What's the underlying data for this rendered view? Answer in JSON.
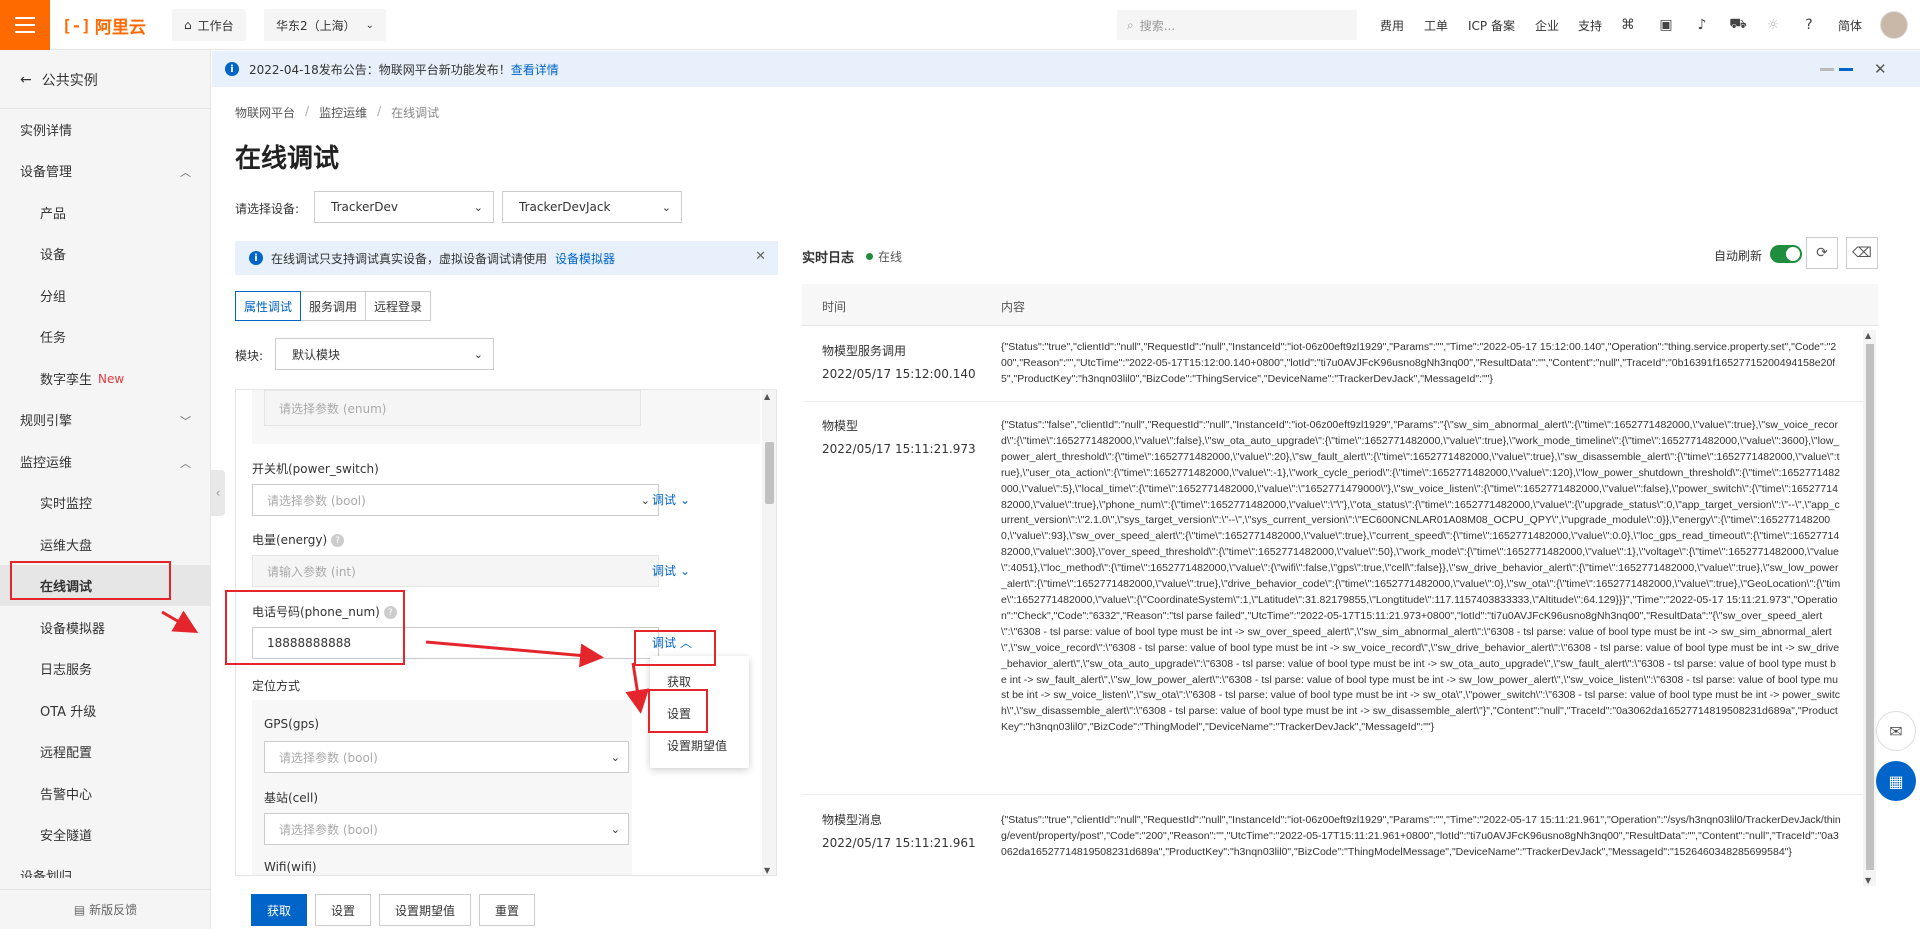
{
  "header": {
    "brand": "阿里云",
    "workbench": "工作台",
    "region": "华东2（上海）",
    "search_placeholder": "搜索...",
    "nav": [
      "费用",
      "工单",
      "ICP 备案",
      "企业",
      "支持"
    ],
    "lang": "简体"
  },
  "sidebar": {
    "back": "公共实例",
    "items": [
      {
        "label": "实例详情"
      },
      {
        "label": "设备管理"
      },
      {
        "label": "产品"
      },
      {
        "label": "设备"
      },
      {
        "label": "分组"
      },
      {
        "label": "任务"
      },
      {
        "label": "数字孪生",
        "badge": "New"
      },
      {
        "label": "规则引擎"
      },
      {
        "label": "监控运维"
      },
      {
        "label": "实时监控"
      },
      {
        "label": "运维大盘"
      },
      {
        "label": "在线调试"
      },
      {
        "label": "设备模拟器"
      },
      {
        "label": "日志服务"
      },
      {
        "label": "OTA 升级"
      },
      {
        "label": "远程配置"
      },
      {
        "label": "告警中心"
      },
      {
        "label": "安全隧道"
      },
      {
        "label": "设备划归"
      }
    ],
    "feedback": "新版反馈"
  },
  "announcement": {
    "text": "2022-04-18发布公告：物联网平台新功能发布！",
    "link": "查看详情"
  },
  "breadcrumb": [
    "物联网平台",
    "监控运维",
    "在线调试"
  ],
  "page_title": "在线调试",
  "device_select": {
    "label": "请选择设备:",
    "product": "TrackerDev",
    "device": "TrackerDevJack"
  },
  "tip": {
    "text": "在线调试只支持调试真实设备，虚拟设备调试请使用",
    "link": "设备模拟器"
  },
  "tabs": [
    "属性调试",
    "服务调用",
    "远程登录"
  ],
  "module": {
    "label": "模块:",
    "value": "默认模块"
  },
  "properties": {
    "enum_placeholder": "请选择参数 (enum)",
    "power_switch": {
      "label": "开关机(power_switch)",
      "placeholder": "请选择参数 (bool)"
    },
    "energy": {
      "label": "电量(energy)",
      "placeholder": "请输入参数 (int)"
    },
    "phone_num": {
      "label": "电话号码(phone_num)",
      "value": "18888888888"
    },
    "location": {
      "label": "定位方式"
    },
    "gps": {
      "label": "GPS(gps)",
      "placeholder": "请选择参数 (bool)"
    },
    "cell": {
      "label": "基站(cell)",
      "placeholder": "请选择参数 (bool)"
    },
    "wifi": {
      "label": "Wifi(wifi)"
    },
    "debug": "调试"
  },
  "debug_menu": [
    "获取",
    "设置",
    "设置期望值"
  ],
  "actions": [
    "获取",
    "设置",
    "设置期望值",
    "重置"
  ],
  "log": {
    "title": "实时日志",
    "status": "在线",
    "auto_refresh": "自动刷新",
    "col_time": "时间",
    "col_content": "内容",
    "rows": [
      {
        "type": "物模型服务调用",
        "time": "2022/05/17 15:12:00.140",
        "content": "{\"Status\":\"true\",\"clientId\":\"null\",\"RequestId\":\"null\",\"InstanceId\":\"iot-06z00eft9zl1929\",\"Params\":\"\",\"Time\":\"2022-05-17 15:12:00.140\",\"Operation\":\"thing.service.property.set\",\"Code\":\"200\",\"Reason\":\"\",\"UtcTime\":\"2022-05-17T15:12:00.140+0800\",\"lotId\":\"ti7u0AVJFcK96usno8gNh3nq00\",\"ResultData\":\"\",\"Content\":\"null\",\"TraceId\":\"0b16391f16527715200494158e20f5\",\"ProductKey\":\"h3nqn03lil0\",\"BizCode\":\"ThingService\",\"DeviceName\":\"TrackerDevJack\",\"MessageId\":\"\"}"
      },
      {
        "type": "物模型",
        "time": "2022/05/17 15:11:21.973",
        "content": "{\"Status\":\"false\",\"clientId\":\"null\",\"RequestId\":\"null\",\"InstanceId\":\"iot-06z00eft9zl1929\",\"Params\":\"{\\\"sw_sim_abnormal_alert\\\":{\\\"time\\\":1652771482000,\\\"value\\\":true},\\\"sw_voice_record\\\":{\\\"time\\\":1652771482000,\\\"value\\\":false},\\\"sw_ota_auto_upgrade\\\":{\\\"time\\\":1652771482000,\\\"value\\\":true},\\\"work_mode_timeline\\\":{\\\"time\\\":1652771482000,\\\"value\\\":3600},\\\"low_power_alert_threshold\\\":{\\\"time\\\":1652771482000,\\\"value\\\":20},\\\"sw_fault_alert\\\":{\\\"time\\\":1652771482000,\\\"value\\\":true},\\\"sw_disassemble_alert\\\":{\\\"time\\\":1652771482000,\\\"value\\\":true},\\\"user_ota_action\\\":{\\\"time\\\":1652771482000,\\\"value\\\":-1},\\\"work_cycle_period\\\":{\\\"time\\\":1652771482000,\\\"value\\\":120},\\\"low_power_shutdown_threshold\\\":{\\\"time\\\":1652771482000,\\\"value\\\":5},\\\"local_time\\\":{\\\"time\\\":1652771482000,\\\"value\\\":\\\"1652771479000\\\"},\\\"sw_voice_listen\\\":{\\\"time\\\":1652771482000,\\\"value\\\":false},\\\"power_switch\\\":{\\\"time\\\":1652771482000,\\\"value\\\":true},\\\"phone_num\\\":{\\\"time\\\":1652771482000,\\\"value\\\":\\\"\\\"},\\\"ota_status\\\":{\\\"time\\\":1652771482000,\\\"value\\\":{\\\"upgrade_status\\\":0,\\\"app_target_version\\\":\\\"--\\\",\\\"app_current_version\\\":\\\"2.1.0\\\",\\\"sys_target_version\\\":\\\"--\\\",\\\"sys_current_version\\\":\\\"EC600NCNLAR01A08M08_OCPU_QPY\\\",\\\"upgrade_module\\\":0}},\\\"energy\\\":{\\\"time\\\":1652771482000,\\\"value\\\":93},\\\"sw_over_speed_alert\\\":{\\\"time\\\":1652771482000,\\\"value\\\":true},\\\"current_speed\\\":{\\\"time\\\":1652771482000,\\\"value\\\":0.0},\\\"loc_gps_read_timeout\\\":{\\\"time\\\":1652771482000,\\\"value\\\":300},\\\"over_speed_threshold\\\":{\\\"time\\\":1652771482000,\\\"value\\\":50},\\\"work_mode\\\":{\\\"time\\\":1652771482000,\\\"value\\\":1},\\\"voltage\\\":{\\\"time\\\":1652771482000,\\\"value\\\":4051},\\\"loc_method\\\":{\\\"time\\\":1652771482000,\\\"value\\\":{\\\"wifi\\\":false,\\\"gps\\\":true,\\\"cell\\\":false}},\\\"sw_drive_behavior_alert\\\":{\\\"time\\\":1652771482000,\\\"value\\\":true},\\\"sw_low_power_alert\\\":{\\\"time\\\":1652771482000,\\\"value\\\":true},\\\"drive_behavior_code\\\":{\\\"time\\\":1652771482000,\\\"value\\\":0},\\\"sw_ota\\\":{\\\"time\\\":1652771482000,\\\"value\\\":true},\\\"GeoLocation\\\":{\\\"time\\\":1652771482000,\\\"value\\\":{\\\"CoordinateSystem\\\":1,\\\"Latitude\\\":31.82179855,\\\"Longtitude\\\":117.1157403833333,\\\"Altitude\\\":64.129}}}\",\"Time\":\"2022-05-17 15:11:21.973\",\"Operation\":\"Check\",\"Code\":\"6332\",\"Reason\":\"tsl parse failed\",\"UtcTime\":\"2022-05-17T15:11:21.973+0800\",\"lotId\":\"ti7u0AVJFcK96usno8gNh3nq00\",\"ResultData\":\"{\\\"sw_over_speed_alert\\\":\\\"6308 - tsl parse: value of bool type must be int -> sw_over_speed_alert\\\",\\\"sw_sim_abnormal_alert\\\":\\\"6308 - tsl parse: value of bool type must be int -> sw_sim_abnormal_alert\\\",\\\"sw_voice_record\\\":\\\"6308 - tsl parse: value of bool type must be int -> sw_voice_record\\\",\\\"sw_drive_behavior_alert\\\":\\\"6308 - tsl parse: value of bool type must be int -> sw_drive_behavior_alert\\\",\\\"sw_ota_auto_upgrade\\\":\\\"6308 - tsl parse: value of bool type must be int -> sw_ota_auto_upgrade\\\",\\\"sw_fault_alert\\\":\\\"6308 - tsl parse: value of bool type must be int -> sw_fault_alert\\\",\\\"sw_low_power_alert\\\":\\\"6308 - tsl parse: value of bool type must be int -> sw_low_power_alert\\\",\\\"sw_voice_listen\\\":\\\"6308 - tsl parse: value of bool type must be int -> sw_voice_listen\\\",\\\"sw_ota\\\":\\\"6308 - tsl parse: value of bool type must be int -> sw_ota\\\",\\\"power_switch\\\":\\\"6308 - tsl parse: value of bool type must be int -> power_switch\\\",\\\"sw_disassemble_alert\\\":\\\"6308 - tsl parse: value of bool type must be int -> sw_disassemble_alert\\\"}\",\"Content\":\"null\",\"TraceId\":\"0a3062da16527714819508231d689a\",\"ProductKey\":\"h3nqn03lil0\",\"BizCode\":\"ThingModel\",\"DeviceName\":\"TrackerDevJack\",\"MessageId\":\"\"}"
      },
      {
        "type": "物模型消息",
        "time": "2022/05/17 15:11:21.961",
        "content": "{\"Status\":\"true\",\"clientId\":\"null\",\"RequestId\":\"null\",\"InstanceId\":\"iot-06z00eft9zl1929\",\"Params\":\"\",\"Time\":\"2022-05-17 15:11:21.961\",\"Operation\":\"/sys/h3nqn03lil0/TrackerDevJack/thing/event/property/post\",\"Code\":\"200\",\"Reason\":\"\",\"UtcTime\":\"2022-05-17T15:11:21.961+0800\",\"lotId\":\"ti7u0AVJFcK96usno8gNh3nq00\",\"ResultData\":\"\",\"Content\":\"null\",\"TraceId\":\"0a3062da16527714819508231d689a\",\"ProductKey\":\"h3nqn03lil0\",\"BizCode\":\"ThingModelMessage\",\"DeviceName\":\"TrackerDevJack\",\"MessageId\":\"1526460348285699584\"}"
      }
    ]
  },
  "colors": {
    "brand": "#ff6a00",
    "primary": "#0064c8",
    "online": "#1e8e3e",
    "annotation": "#e4262c"
  }
}
